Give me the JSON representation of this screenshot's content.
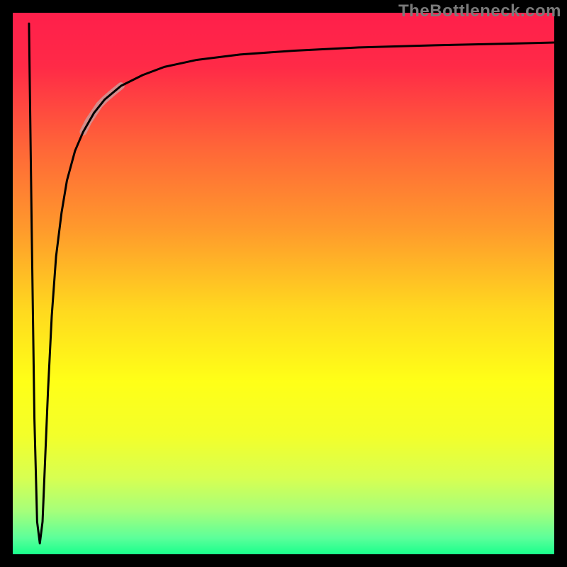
{
  "watermark": "TheBottleneck.com",
  "chart_data": {
    "type": "line",
    "title": "",
    "xlabel": "",
    "ylabel": "",
    "xlim": [
      0,
      100
    ],
    "ylim": [
      0,
      100
    ],
    "grid": false,
    "legend": false,
    "annotations": [],
    "background_gradient_stops": [
      {
        "offset": 0.0,
        "color": "#ff1f4b"
      },
      {
        "offset": 0.1,
        "color": "#ff2a47"
      },
      {
        "offset": 0.25,
        "color": "#ff6638"
      },
      {
        "offset": 0.4,
        "color": "#ff9a2c"
      },
      {
        "offset": 0.55,
        "color": "#ffd91f"
      },
      {
        "offset": 0.68,
        "color": "#ffff17"
      },
      {
        "offset": 0.78,
        "color": "#f3ff2a"
      },
      {
        "offset": 0.86,
        "color": "#d7ff52"
      },
      {
        "offset": 0.92,
        "color": "#a6ff7a"
      },
      {
        "offset": 0.97,
        "color": "#5cff9a"
      },
      {
        "offset": 1.0,
        "color": "#19ff8c"
      }
    ],
    "frame_color": "#000000",
    "frame_thickness_px": 18,
    "series": [
      {
        "name": "bottleneck-curve",
        "color": "#000000",
        "stroke_px": 3,
        "x": [
          3.0,
          3.5,
          4.0,
          4.5,
          5.0,
          5.5,
          6.0,
          6.5,
          7.2,
          8.0,
          9.0,
          10.0,
          11.5,
          13.0,
          15.0,
          17.0,
          20.0,
          24.0,
          28.0,
          34.0,
          42.0,
          52.0,
          64.0,
          78.0,
          92.0,
          100.0
        ],
        "y": [
          98.0,
          60.0,
          25.0,
          6.0,
          2.0,
          6.0,
          18.0,
          30.0,
          44.0,
          55.0,
          63.0,
          69.0,
          74.5,
          78.0,
          81.5,
          84.0,
          86.5,
          88.5,
          90.0,
          91.3,
          92.3,
          93.0,
          93.6,
          94.0,
          94.3,
          94.5
        ]
      }
    ],
    "highlight_segment": {
      "color": "#cf9394",
      "stroke_px": 10,
      "opacity": 0.9,
      "x": [
        13.0,
        14.0,
        15.0,
        16.0,
        17.0,
        18.5,
        20.0
      ],
      "y": [
        78.0,
        80.0,
        81.5,
        83.0,
        84.0,
        85.3,
        86.5
      ]
    }
  }
}
